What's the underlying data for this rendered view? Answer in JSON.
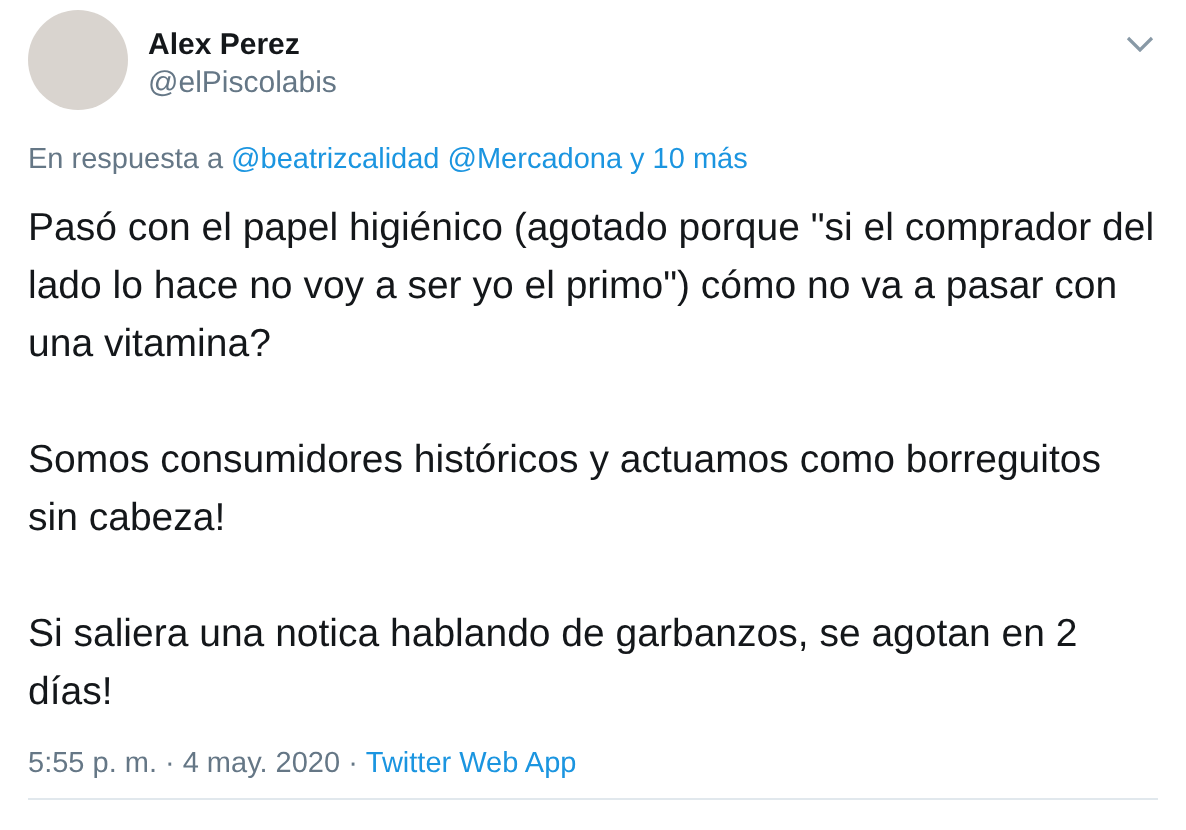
{
  "author": {
    "name": "Alex Perez",
    "handle": "@elPiscolabis"
  },
  "reply_to": {
    "prefix": "En respuesta a",
    "links": [
      "@beatrizcalidad",
      "@Mercadona",
      "y 10 más"
    ]
  },
  "paragraphs": [
    "Pasó con el papel higiénico (agotado porque \"si el comprador del lado lo hace no voy a ser yo el primo\") cómo no va a pasar con una vitamina?",
    "Somos consumidores históricos y actuamos como borreguitos sin cabeza!",
    "Si saliera una notica hablando de garbanzos, se agotan en 2 días!"
  ],
  "footer": {
    "time": "5:55 p. m.",
    "separator": "·",
    "date": "4 may. 2020",
    "separator_2": "·",
    "source": "Twitter Web App"
  }
}
